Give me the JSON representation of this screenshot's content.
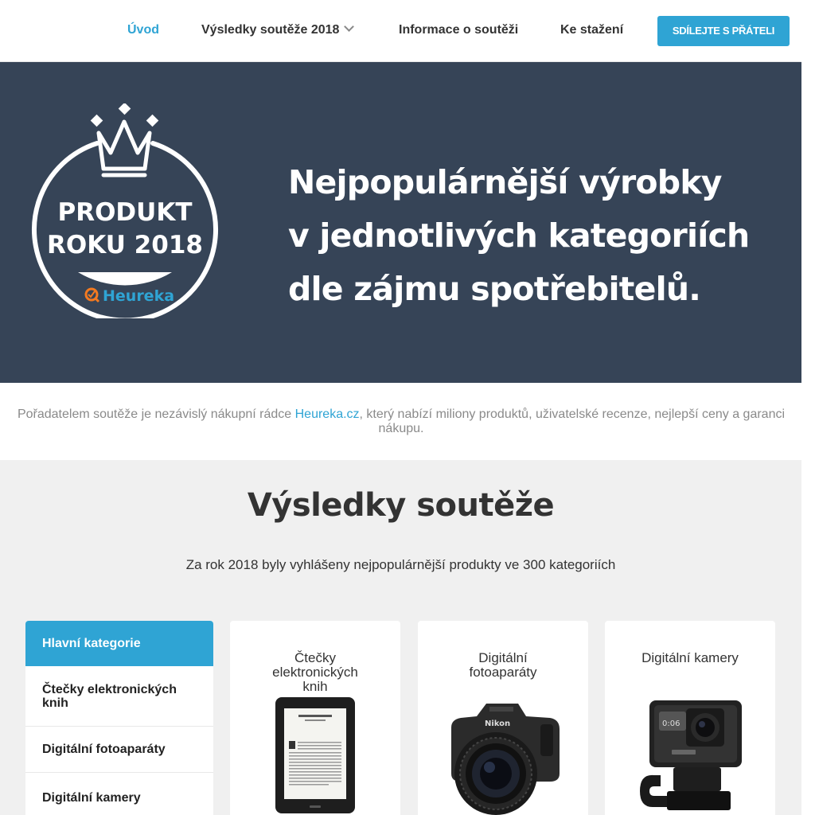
{
  "nav": {
    "items": [
      {
        "label": "Úvod",
        "active": true
      },
      {
        "label": "Výsledky soutěže 2018",
        "has_dropdown": true
      },
      {
        "label": "Informace o soutěži"
      },
      {
        "label": "Ke stažení"
      }
    ],
    "share_button": "SDÍLEJTE S PŘÁTELI"
  },
  "hero": {
    "badge": {
      "line1": "PRODUKT",
      "line2": "ROKU 2018",
      "brand": "Heureka"
    },
    "headline": [
      "Nejpopulárnější výrobky",
      "v jednotlivých kategoriích",
      "dle zájmu spotřebitelů."
    ]
  },
  "intro": {
    "before_link": "Pořadatelem soutěže je nezávislý nákupní rádce ",
    "link": "Heureka.cz",
    "after_link": ", který nabízí miliony produktů, uživatelské recenze, nejlepší ceny a garanci nákupu."
  },
  "results": {
    "title": "Výsledky soutěže",
    "subtitle": "Za rok 2018 byly vyhlášeny nejpopulárnější produkty ve 300 kategoriích"
  },
  "sidebar": {
    "header": "Hlavní kategorie",
    "items": [
      "Čtečky elektronických knih",
      "Digitální fotoaparáty",
      "Digitální kamery"
    ]
  },
  "cards": [
    {
      "title": "Čtečky elektronických knih",
      "icon": "ebook-reader-image"
    },
    {
      "title": "Digitální fotoaparáty",
      "icon": "dslr-camera-image"
    },
    {
      "title": "Digitální kamery",
      "icon": "action-camera-image"
    }
  ],
  "colors": {
    "accent": "#2fa4d4",
    "hero_bg": "#364457",
    "brand_orange": "#f47a20"
  }
}
